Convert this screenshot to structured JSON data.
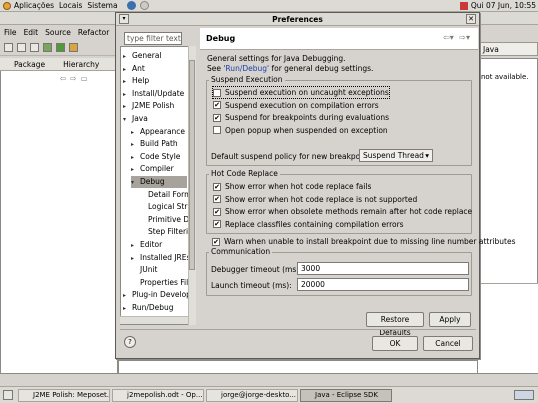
{
  "top_panel": {
    "menus": [
      "Aplicações",
      "Locais",
      "Sistema"
    ],
    "clock": "Qui 07 Jun, 10:55"
  },
  "eclipse": {
    "menubar": [
      "File",
      "Edit",
      "Source",
      "Refactor",
      "N"
    ],
    "views": {
      "package_tab": "Package",
      "hierarchy_tab": "Hierarchy"
    },
    "perspective": "Java",
    "not_available": "not available."
  },
  "dialog": {
    "title": "Preferences",
    "filter_placeholder": "type filter text",
    "tree": [
      {
        "label": "General",
        "expandable": true,
        "level": 0
      },
      {
        "label": "Ant",
        "expandable": true,
        "level": 0
      },
      {
        "label": "Help",
        "expandable": true,
        "level": 0
      },
      {
        "label": "Install/Update",
        "expandable": true,
        "level": 0
      },
      {
        "label": "J2ME Polish",
        "expandable": true,
        "level": 0
      },
      {
        "label": "Java",
        "expandable": true,
        "expanded": true,
        "level": 0
      },
      {
        "label": "Appearance",
        "expandable": true,
        "level": 1
      },
      {
        "label": "Build Path",
        "expandable": true,
        "level": 1
      },
      {
        "label": "Code Style",
        "expandable": true,
        "level": 1
      },
      {
        "label": "Compiler",
        "expandable": true,
        "level": 1
      },
      {
        "label": "Debug",
        "expandable": true,
        "expanded": true,
        "level": 1,
        "selected": true
      },
      {
        "label": "Detail Formatters",
        "level": 2
      },
      {
        "label": "Logical Structures",
        "level": 2
      },
      {
        "label": "Primitive Display",
        "level": 2
      },
      {
        "label": "Step Filtering",
        "level": 2
      },
      {
        "label": "Editor",
        "expandable": true,
        "level": 1
      },
      {
        "label": "Installed JREs",
        "expandable": true,
        "level": 1
      },
      {
        "label": "JUnit",
        "level": 1
      },
      {
        "label": "Properties Files",
        "level": 1
      },
      {
        "label": "Plug-in Development",
        "expandable": true,
        "level": 0
      },
      {
        "label": "Run/Debug",
        "expandable": true,
        "level": 0
      }
    ],
    "page": {
      "title": "Debug",
      "description": "General settings for Java Debugging.",
      "see_prefix": "See ",
      "see_link": "'Run/Debug'",
      "see_suffix": " for general debug settings.",
      "suspend": {
        "label": "Suspend Execution",
        "options": [
          {
            "label": "Suspend execution on uncaught exceptions",
            "checked": false,
            "focused": true
          },
          {
            "label": "Suspend execution on compilation errors",
            "checked": true
          },
          {
            "label": "Suspend for breakpoints during evaluations",
            "checked": true
          },
          {
            "label": "Open popup when suspended on exception",
            "checked": false
          }
        ],
        "policy_label": "Default suspend policy for new breakpoints:",
        "policy_value": "Suspend Thread"
      },
      "hcr": {
        "label": "Hot Code Replace",
        "options": [
          {
            "label": "Show error when hot code replace fails",
            "checked": true
          },
          {
            "label": "Show error when hot code replace is not supported",
            "checked": true
          },
          {
            "label": "Show error when obsolete methods remain after hot code replace",
            "checked": true
          },
          {
            "label": "Replace classfiles containing compilation errors",
            "checked": true
          }
        ]
      },
      "warn": {
        "label": "Warn when unable to install breakpoint due to missing line number attributes",
        "checked": true
      },
      "communication": {
        "label": "Communication",
        "debugger_timeout_label": "Debugger timeout (ms):",
        "debugger_timeout_value": "3000",
        "launch_timeout_label": "Launch timeout (ms):",
        "launch_timeout_value": "20000"
      },
      "restore_defaults": "Restore Defaults",
      "apply": "Apply"
    },
    "ok": "OK",
    "cancel": "Cancel"
  },
  "taskbar": {
    "tasks": [
      {
        "label": "J2ME Polish: Meposet...",
        "active": false
      },
      {
        "label": "j2mepolish.odt - Op...",
        "active": false
      },
      {
        "label": "jorge@jorge-deskto...",
        "active": false
      },
      {
        "label": "Java - Eclipse SDK",
        "active": true
      }
    ]
  }
}
